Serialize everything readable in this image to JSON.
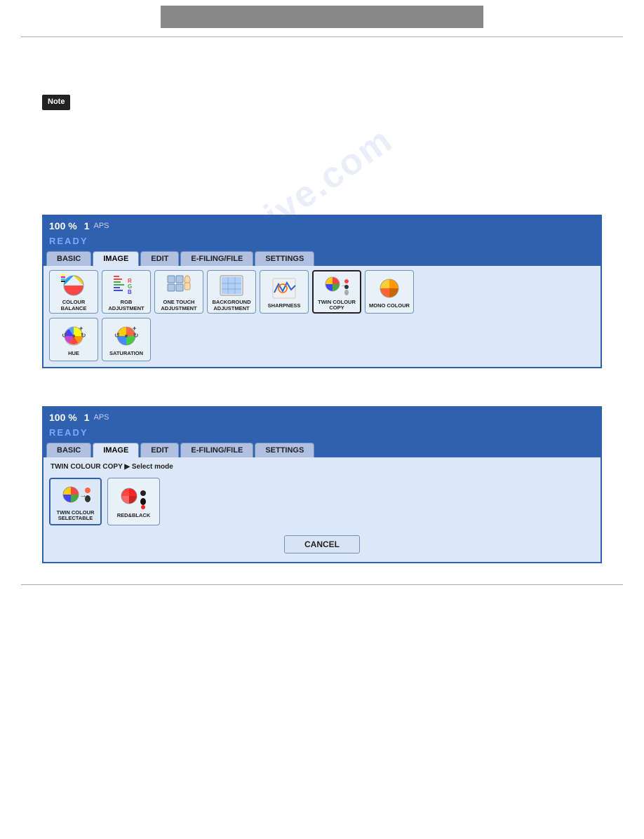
{
  "header": {
    "bar_bg": "#888"
  },
  "body": {
    "paragraphs": [
      "",
      "",
      "",
      ""
    ],
    "note_label": "Note"
  },
  "watermark": "manualaive.com",
  "panel1": {
    "status": {
      "percent": "100 %",
      "copies": "1",
      "aps": "APS"
    },
    "ready": "READY",
    "tabs": [
      "BASIC",
      "IMAGE",
      "EDIT",
      "E-FILING/FILE",
      "SETTINGS"
    ],
    "active_tab": "IMAGE",
    "row1_buttons": [
      {
        "id": "colour-balance",
        "label": "COLOUR BALANCE",
        "selected": false
      },
      {
        "id": "rgb-adjustment",
        "label": "RGB\nADJUSTMENT",
        "selected": false
      },
      {
        "id": "one-touch",
        "label": "ONE TOUCH\nADJUSTMENT",
        "selected": false
      },
      {
        "id": "background-adj",
        "label": "BACKGROUND\nADJUSTMENT",
        "selected": false
      },
      {
        "id": "sharpness",
        "label": "SHARPNESS",
        "selected": false
      },
      {
        "id": "twin-colour",
        "label": "TWIN COLOUR\nCOPY",
        "selected": true
      },
      {
        "id": "mono-colour",
        "label": "MONO COLOUR",
        "selected": false
      }
    ],
    "row2_buttons": [
      {
        "id": "hue",
        "label": "HUE",
        "selected": false
      },
      {
        "id": "saturation",
        "label": "SATURATION",
        "selected": false
      }
    ]
  },
  "panel2": {
    "status": {
      "percent": "100 %",
      "copies": "1",
      "aps": "APS"
    },
    "ready": "READY",
    "tabs": [
      "BASIC",
      "IMAGE",
      "EDIT",
      "E-FILING/FILE",
      "SETTINGS"
    ],
    "active_tab": "IMAGE",
    "breadcrumb": "TWIN COLOUR COPY",
    "breadcrumb_sep": "▶",
    "breadcrumb_sub": "Select mode",
    "mode_buttons": [
      {
        "id": "twin-colour-selectable",
        "label": "TWIN COLOUR\nSELECTABLE",
        "active": true
      },
      {
        "id": "red-and-black",
        "label": "RED&BLACK",
        "active": false
      }
    ],
    "cancel_label": "CANCEL"
  }
}
